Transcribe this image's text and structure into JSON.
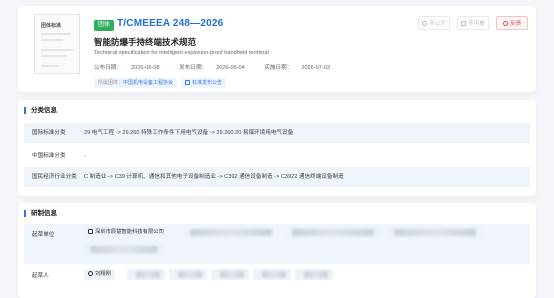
{
  "header": {
    "badge": "团体",
    "code": "T/CMEEEA 248—2026",
    "title_cn": "智能防爆手持终端技术规范",
    "title_en": "Technical specification for intelligent explosion-proof handheld terminal",
    "pub_label": "公布日期：",
    "pub_date": "2026-06-08",
    "issue_label": "发布日期：",
    "issue_date": "2026-06-04",
    "impl_label": "实施日期：",
    "impl_date": "2026-07-03",
    "org_label": "所属团体：",
    "org": "中国机电设备工程协会",
    "notice": "标准发布公告",
    "thumb_title": "团体标准"
  },
  "actions": {
    "unpublic": "不公开",
    "discard": "不可看",
    "feedback": "反馈"
  },
  "classification": {
    "section_title": "分类信息",
    "rows": [
      {
        "label": "国际标准分类",
        "value": "29 电气工程 -> 29.260 特殊工作条件下用电气设备 -> 29.260.20 易爆环境用电气设备"
      },
      {
        "label": "中国标准分类",
        "value": "-"
      },
      {
        "label": "国民经济行业分类",
        "value": "C 制造业 -> C39 计算机、通信和其他电子设备制造业 -> C392 通信设备制造 -> C3922 通信终端设备制造"
      }
    ]
  },
  "development": {
    "section_title": "研制信息",
    "drafter_label": "起草单位",
    "drafter_first": "深圳市辰楚智能科技有限公司",
    "people_label": "起草人",
    "person_first": "刘翔刚"
  }
}
